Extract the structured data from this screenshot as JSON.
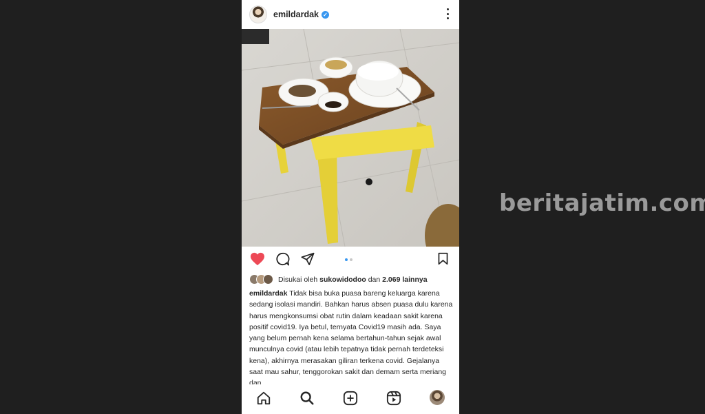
{
  "post": {
    "username": "emildardak",
    "verified": true
  },
  "likes": {
    "prefix": "Disukai oleh",
    "liker": "sukowidodoo",
    "conj": "dan",
    "others": "2.069 lainnya"
  },
  "caption": {
    "username": "emildardak",
    "text": "Tidak bisa buka puasa bareng keluarga karena sedang isolasi mandiri. Bahkan harus absen puasa dulu karena harus mengkonsumsi obat rutin dalam keadaan sakit karena positif covid19. Iya betul, ternyata Covid19 masih ada. Saya yang belum pernah kena selama bertahun-tahun sejak awal munculnya covid (atau lebih tepatnya tidak pernah terdeteksi kena), akhirnya merasakan giliran terkena covid. Gejalanya saat mau sahur, tenggorokan sakit dan demam serta meriang dan"
  },
  "carousel": {
    "count": 2,
    "active": 1
  },
  "colors": {
    "like_red": "#ed4956",
    "verified_blue": "#3897f0",
    "background": "#1f1f1f"
  },
  "icons": {
    "like": "heart-filled-icon",
    "comment": "comment-icon",
    "share": "paper-plane-icon",
    "save": "bookmark-icon",
    "home": "home-icon",
    "search": "search-icon",
    "new_post": "plus-square-icon",
    "reels": "reels-icon",
    "profile": "profile-avatar"
  },
  "watermark": "beritajatim.com"
}
